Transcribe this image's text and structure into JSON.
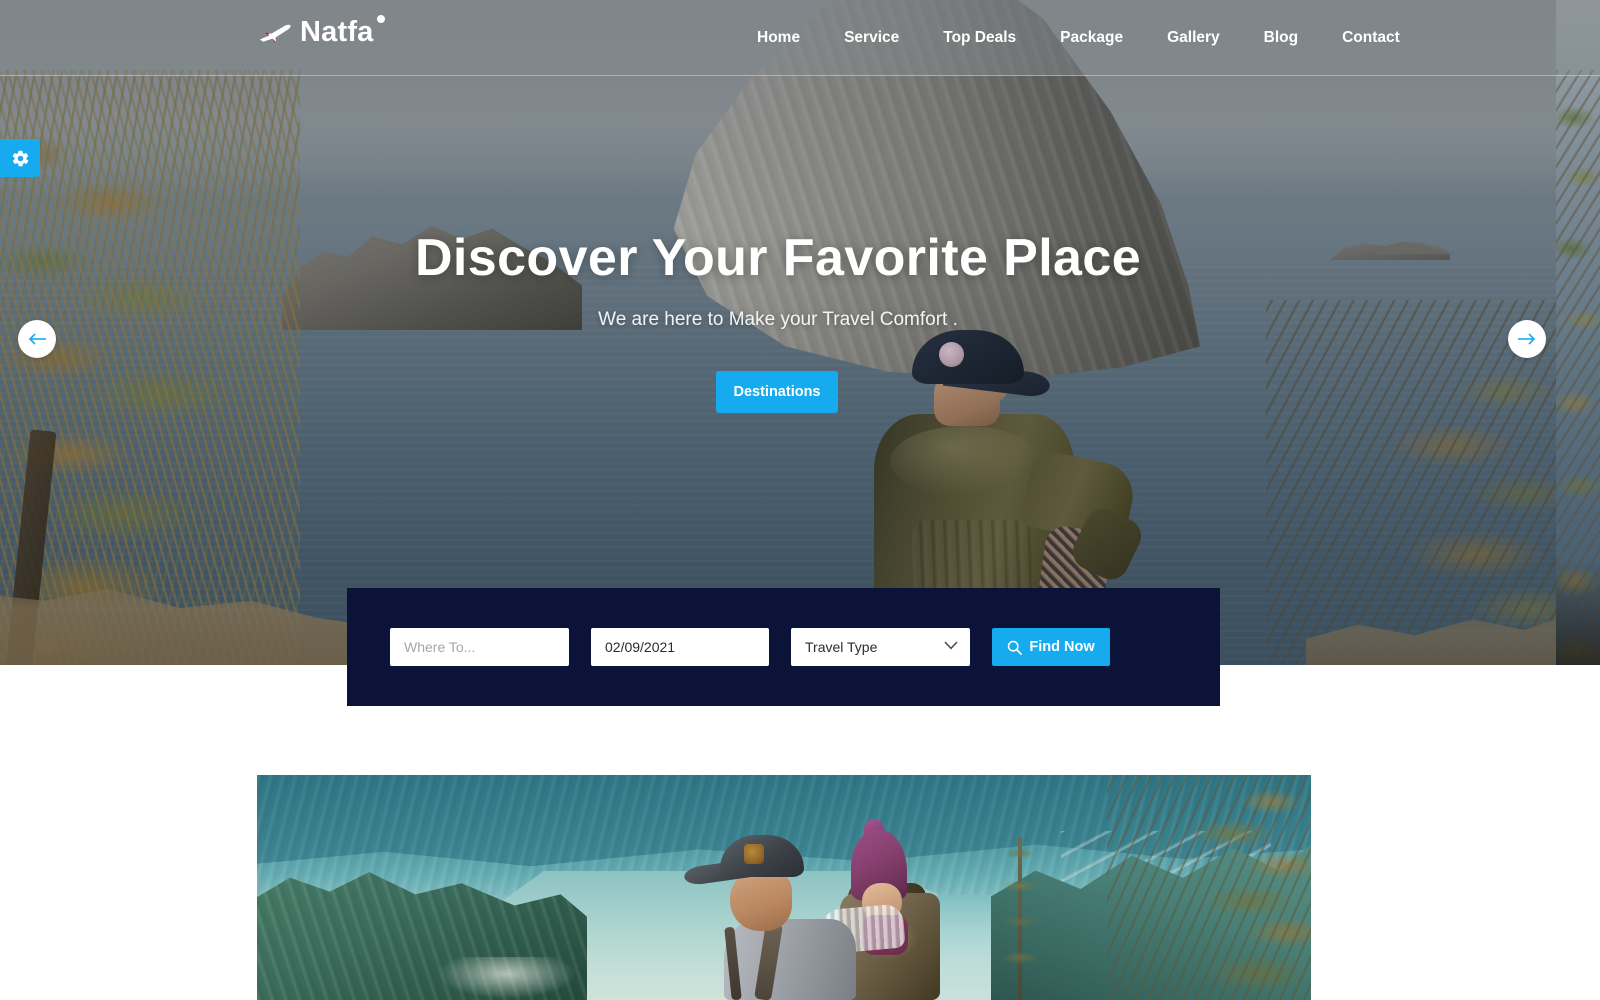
{
  "brand": {
    "name": "Natfa",
    "plane_icon": "airplane-icon",
    "dot": "brand-dot"
  },
  "nav": {
    "items": [
      {
        "label": "Home"
      },
      {
        "label": "Service"
      },
      {
        "label": "Top Deals"
      },
      {
        "label": "Package"
      },
      {
        "label": "Gallery"
      },
      {
        "label": "Blog"
      },
      {
        "label": "Contact"
      }
    ]
  },
  "hero": {
    "title": "Discover Your Favorite Place",
    "subtitle": "We are here to Make your Travel Comfort .",
    "cta_label": "Destinations",
    "prev_arrow": "arrow-left-icon",
    "next_arrow": "arrow-right-icon",
    "background_alt": "Coastal cliff and sea with man looking at view"
  },
  "settings_tab": {
    "icon": "gear-icon"
  },
  "search": {
    "where_placeholder": "Where To...",
    "where_value": "",
    "date_value": "02/09/2021",
    "travel_type_selected": "Travel Type",
    "travel_type_options": [
      "Travel Type"
    ],
    "find_label": "Find Now",
    "find_icon": "search-icon",
    "chevron_icon": "chevron-down-icon"
  },
  "section_two": {
    "image_alt": "Hiker carrying child in backpack carrier above a mountain lake"
  },
  "colors": {
    "accent_blue": "#16ABEF",
    "panel_navy": "#0B1438",
    "white": "#ffffff",
    "header_overlay": "rgba(132,138,140,0.50)"
  }
}
